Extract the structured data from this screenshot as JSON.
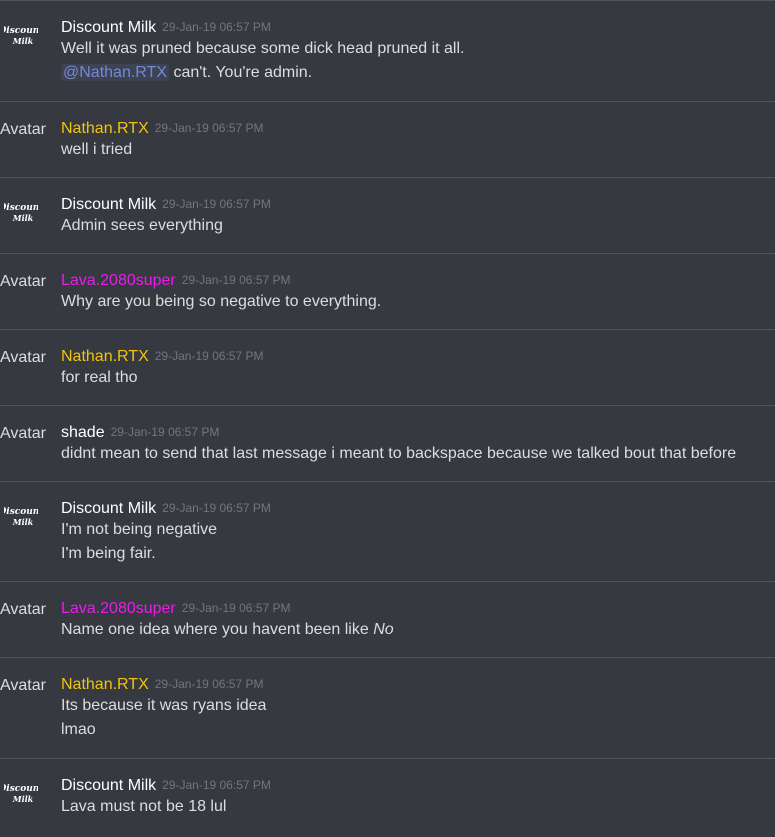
{
  "messages": [
    {
      "author": "Discount Milk",
      "name_color": "#ffffff",
      "avatar": "logo",
      "timestamp": "29-Jan-19 06:57 PM",
      "lines": [
        "Well it was pruned because some dick head pruned it all."
      ],
      "mention_line": {
        "mention": "@Nathan.RTX",
        "text": " can't. You're admin."
      }
    },
    {
      "author": "Nathan.RTX",
      "name_color": "#f1c40f",
      "avatar_text": "Avatar",
      "timestamp": "29-Jan-19 06:57 PM",
      "lines": [
        "well i tried"
      ]
    },
    {
      "author": "Discount Milk",
      "name_color": "#ffffff",
      "avatar": "logo",
      "timestamp": "29-Jan-19 06:57 PM",
      "lines": [
        "Admin sees everything"
      ]
    },
    {
      "author": "Lava.2080super",
      "name_color": "#e91ee9",
      "avatar_text": "Avatar",
      "timestamp": "29-Jan-19 06:57 PM",
      "lines": [
        "Why are you being so negative to everything."
      ]
    },
    {
      "author": "Nathan.RTX",
      "name_color": "#f1c40f",
      "avatar_text": "Avatar",
      "timestamp": "29-Jan-19 06:57 PM",
      "lines": [
        "for real tho"
      ]
    },
    {
      "author": "shade",
      "name_color": "#ffffff",
      "avatar_text": "Avatar",
      "timestamp": "29-Jan-19 06:57 PM",
      "lines": [
        "didnt mean to send that last message i meant to backspace because we talked bout that before"
      ]
    },
    {
      "author": "Discount Milk",
      "name_color": "#ffffff",
      "avatar": "logo",
      "timestamp": "29-Jan-19 06:57 PM",
      "lines": [
        "I'm not being negative",
        "I'm being fair."
      ]
    },
    {
      "author": "Lava.2080super",
      "name_color": "#e91ee9",
      "avatar_text": "Avatar",
      "timestamp": "29-Jan-19 06:57 PM",
      "italic_line": {
        "text": "Name one idea where you havent been like ",
        "italic": "No"
      }
    },
    {
      "author": "Nathan.RTX",
      "name_color": "#f1c40f",
      "avatar_text": "Avatar",
      "timestamp": "29-Jan-19 06:57 PM",
      "lines": [
        "Its because it was ryans idea",
        "lmao"
      ]
    },
    {
      "author": "Discount Milk",
      "name_color": "#ffffff",
      "avatar": "logo",
      "timestamp": "29-Jan-19 06:57 PM",
      "lines": [
        "Lava must not be 18 lul"
      ]
    }
  ],
  "logo_text": {
    "line1": "Discount",
    "line2": "Milk"
  },
  "colors": {
    "background": "#36393f",
    "divider": "#4f545c",
    "text": "#dcddde",
    "timestamp": "#72767d",
    "mention": "#7289da"
  }
}
